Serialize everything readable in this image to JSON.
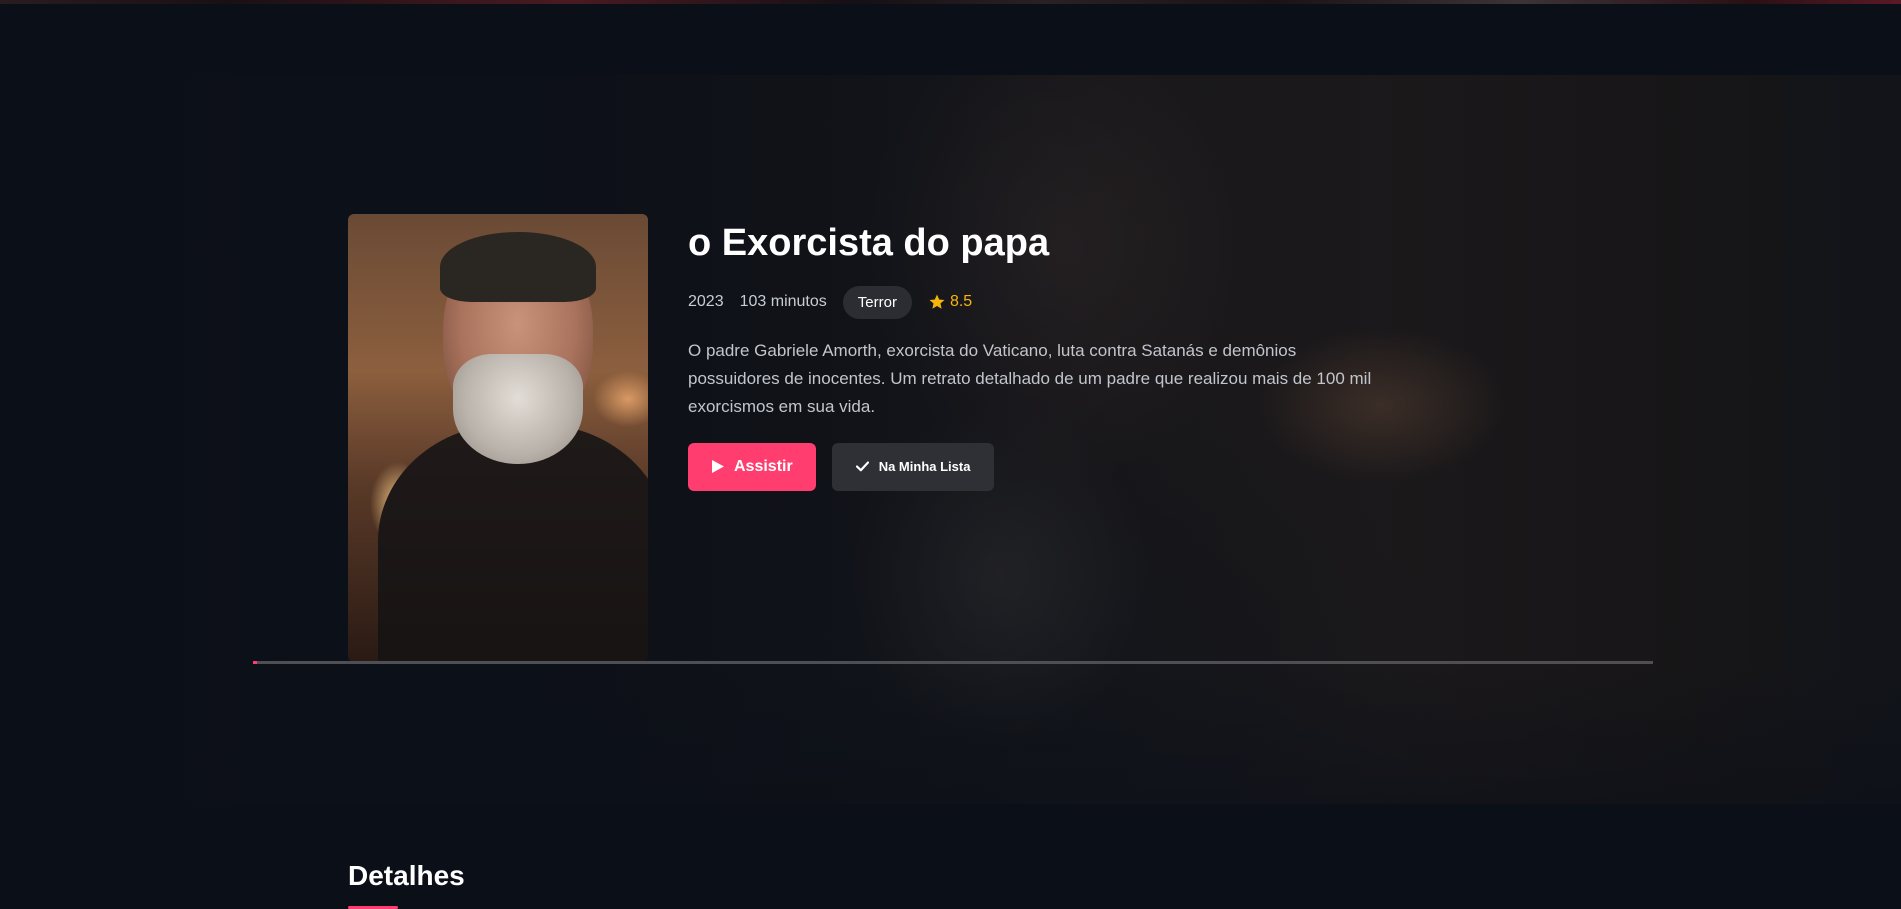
{
  "movie": {
    "title": "o Exorcista do papa",
    "year": "2023",
    "duration": "103 minutos",
    "genre": "Terror",
    "rating": "8.5",
    "description": "O padre Gabriele Amorth, exorcista do Vaticano, luta contra Satanás e demônios possuidores de inocentes. Um retrato detalhado de um padre que realizou mais de 100 mil exorcismos em sua vida."
  },
  "actions": {
    "play_label": "Assistir",
    "list_label": "Na Minha Lista"
  },
  "progress": {
    "fraction": 0.003
  },
  "sections": {
    "details_title": "Detalhes"
  },
  "colors": {
    "accent": "#ff3d6e",
    "background": "#0b0f18",
    "rating_star": "#f5b50a",
    "badge_bg": "#2b2d33"
  },
  "icons": {
    "play": "play-icon",
    "check": "check-icon",
    "star": "star-icon"
  }
}
